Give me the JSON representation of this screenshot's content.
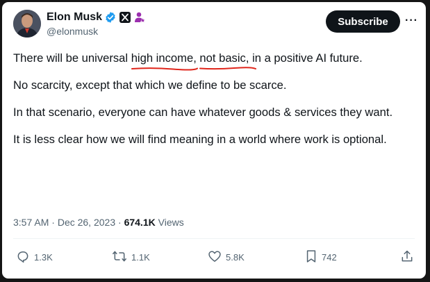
{
  "author": {
    "name": "Elon Musk",
    "handle": "@elonmusk",
    "verified_badge": "verified-check-icon",
    "affiliate_badge": "x-logo-icon",
    "extra_badge": "government-person-icon"
  },
  "header": {
    "subscribe_label": "Subscribe",
    "more_label": "···"
  },
  "tweet": {
    "p1_a": "There will be universal ",
    "p1_high_income": "high income",
    "p1_b": ", ",
    "p1_not_basic": "not basic",
    "p1_c": ", in a positive AI future.",
    "p2": "No scarcity, except that which we define to be scarce.",
    "p3": "In that scenario, everyone can have whatever goods & services they want.",
    "p4": "It is less clear how we will find meaning in a world where work is optional."
  },
  "meta": {
    "time": "3:57 AM",
    "date": "Dec 26, 2023",
    "views_count": "674.1K",
    "views_label": "Views",
    "separator": "·"
  },
  "actions": {
    "replies": "1.3K",
    "reposts": "1.1K",
    "likes": "5.8K",
    "bookmarks": "742"
  },
  "colors": {
    "background": "#151515",
    "card": "#ffffff",
    "text": "#0f1419",
    "muted": "#536471",
    "verified": "#1d9bf0",
    "affiliate": "#9b2fae",
    "annotation": "#e0261c"
  }
}
